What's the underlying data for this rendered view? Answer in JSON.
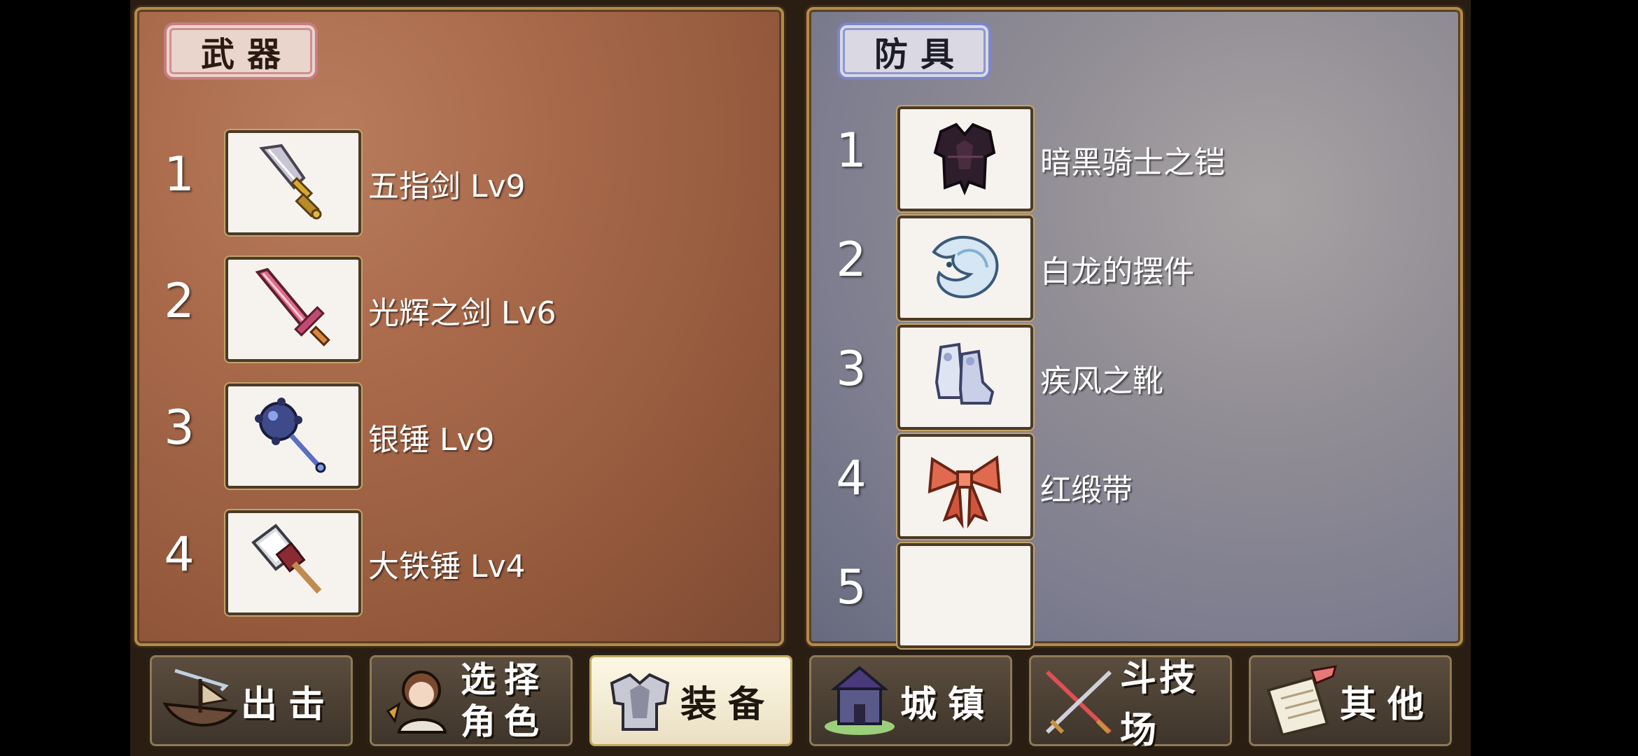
{
  "weapons": {
    "tag": "武器",
    "items": [
      {
        "num": "1",
        "name": "五指剑 Lv9",
        "icon": "dagger-icon"
      },
      {
        "num": "2",
        "name": "光辉之剑 Lv6",
        "icon": "pink-sword-icon"
      },
      {
        "num": "3",
        "name": "银锤 Lv9",
        "icon": "spiked-mace-icon"
      },
      {
        "num": "4",
        "name": "大铁锤 Lv4",
        "icon": "iron-hammer-icon"
      }
    ]
  },
  "armor": {
    "tag": "防具",
    "items": [
      {
        "num": "1",
        "name": "暗黑骑士之铠",
        "icon": "dark-armor-icon"
      },
      {
        "num": "2",
        "name": "白龙的摆件",
        "icon": "white-dragon-icon"
      },
      {
        "num": "3",
        "name": "疾风之靴",
        "icon": "boots-icon"
      },
      {
        "num": "4",
        "name": "红缎带",
        "icon": "red-ribbon-icon"
      },
      {
        "num": "5",
        "name": "",
        "icon": ""
      }
    ]
  },
  "menu": {
    "sortie": "出击",
    "select_line1": "选择",
    "select_line2": "角色",
    "equip": "装备",
    "town": "城镇",
    "arena": "斗技场",
    "other": "其他"
  },
  "colors": {
    "weapon_panel": "#a8694a",
    "armor_panel": "#8a8793",
    "frame_gold": "#b48a4a",
    "active_button": "#fdf8e6"
  }
}
